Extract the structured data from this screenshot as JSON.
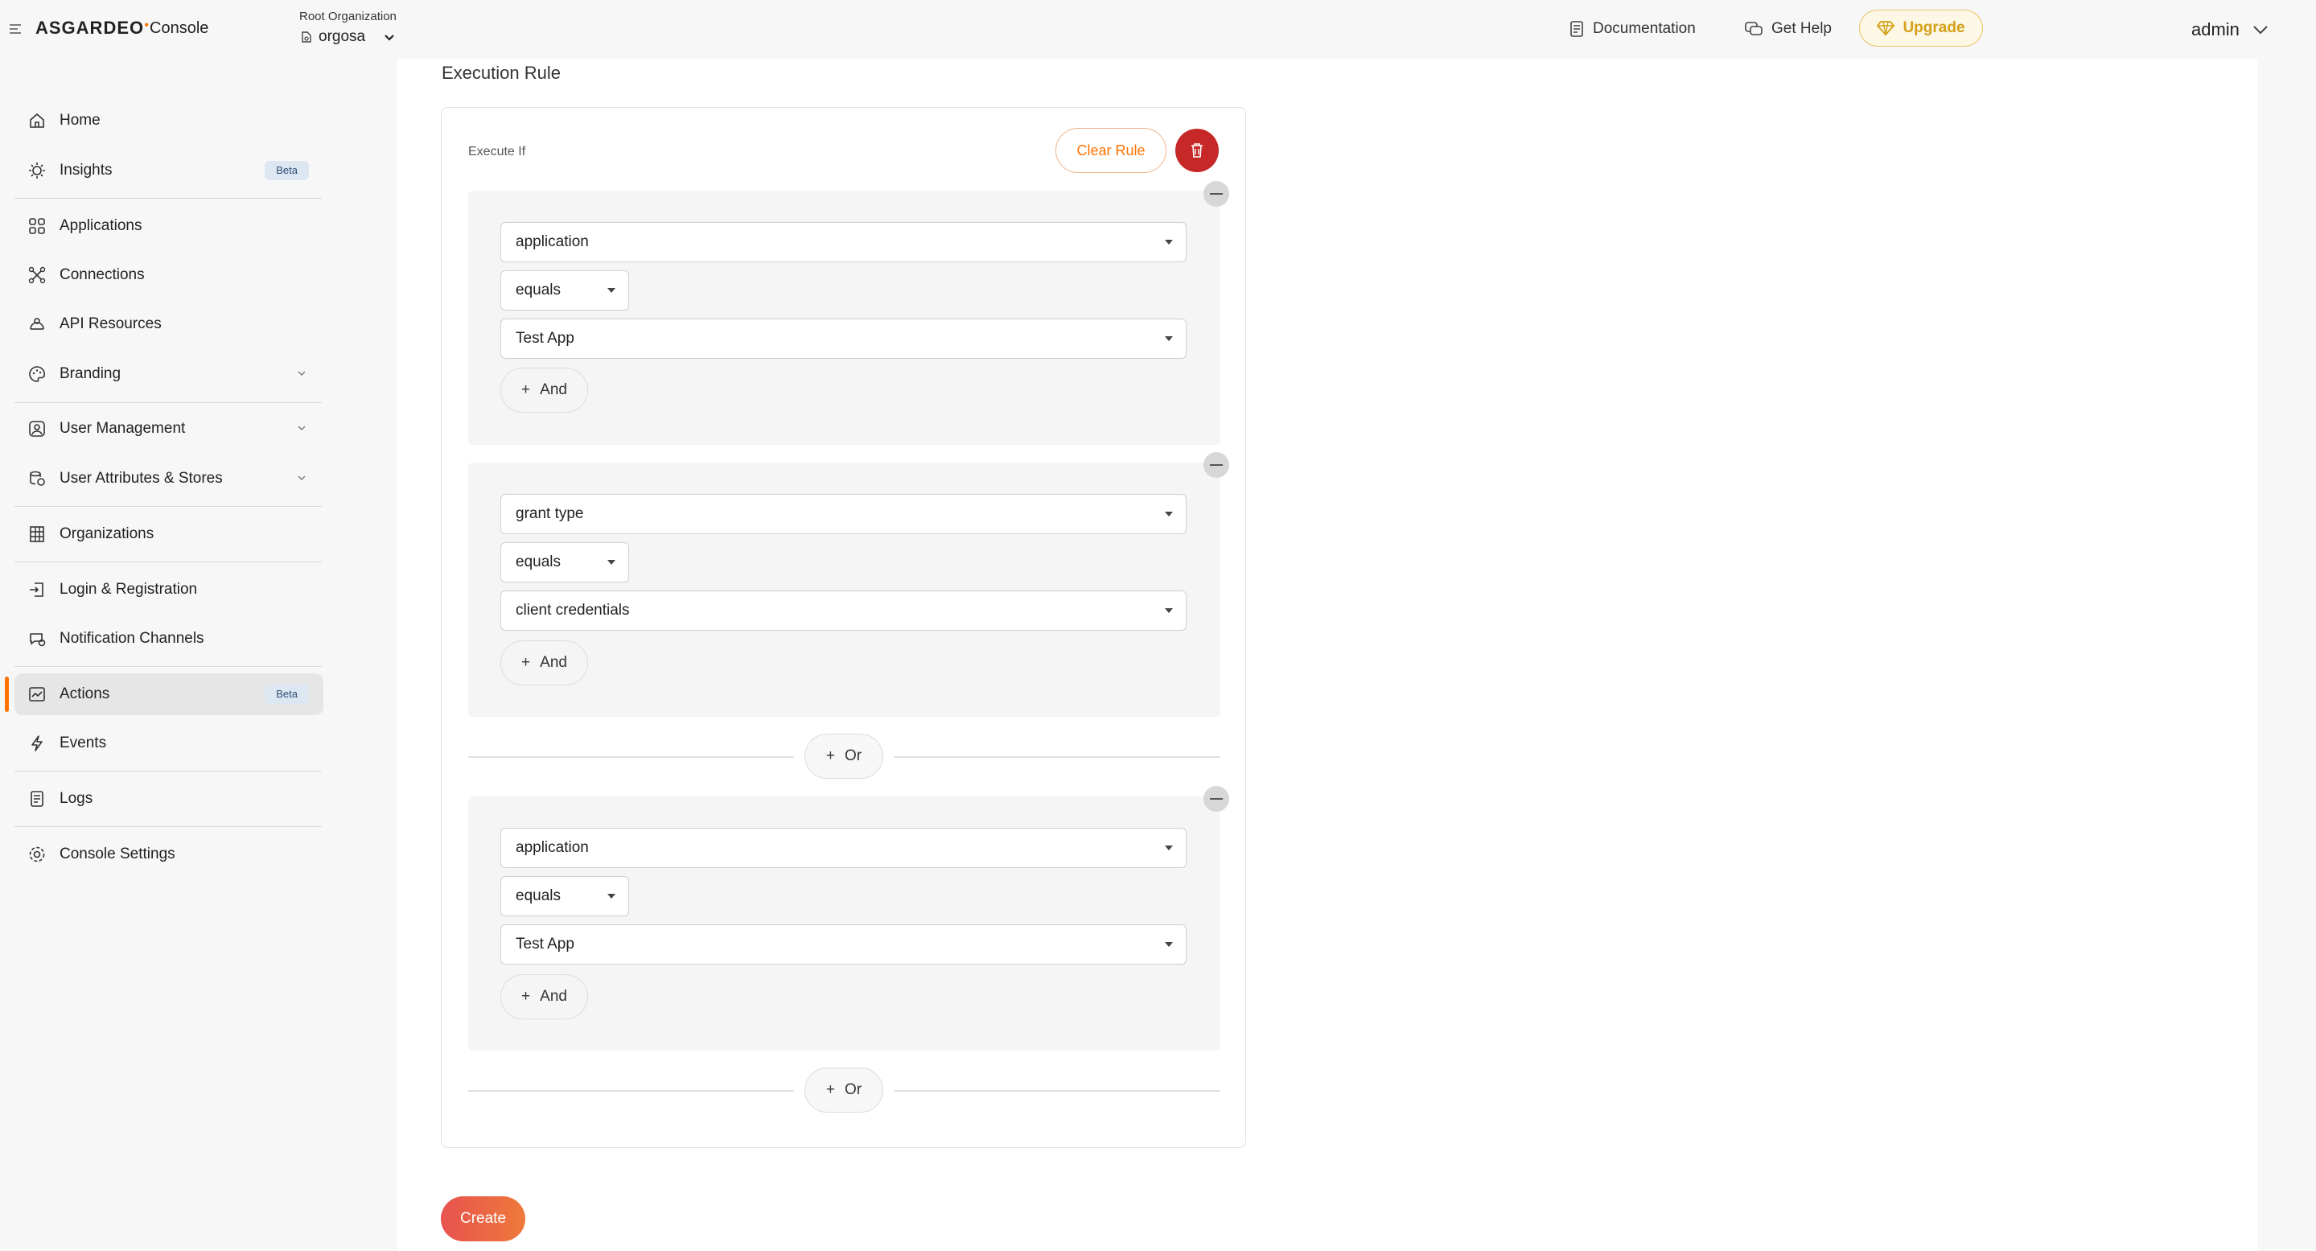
{
  "header": {
    "brand": "ASGARDEO",
    "product": "Console",
    "org_label": "Root Organization",
    "org_name": "orgosa",
    "documentation": "Documentation",
    "get_help": "Get Help",
    "upgrade": "Upgrade",
    "user": "admin"
  },
  "sidebar": {
    "items": [
      {
        "label": "Home",
        "icon": "home-icon"
      },
      {
        "label": "Insights",
        "icon": "lightbulb-icon",
        "badge": "Beta"
      },
      {
        "label": "Applications",
        "icon": "grid-icon"
      },
      {
        "label": "Connections",
        "icon": "connections-icon"
      },
      {
        "label": "API Resources",
        "icon": "api-icon"
      },
      {
        "label": "Branding",
        "icon": "palette-icon",
        "expandable": true
      },
      {
        "label": "User Management",
        "icon": "users-icon",
        "expandable": true
      },
      {
        "label": "User Attributes & Stores",
        "icon": "attributes-icon",
        "expandable": true
      },
      {
        "label": "Organizations",
        "icon": "building-icon"
      },
      {
        "label": "Login & Registration",
        "icon": "login-icon"
      },
      {
        "label": "Notification Channels",
        "icon": "notification-icon"
      },
      {
        "label": "Actions",
        "icon": "actions-icon",
        "badge": "Beta",
        "active": true
      },
      {
        "label": "Events",
        "icon": "lightning-icon"
      },
      {
        "label": "Logs",
        "icon": "logs-icon"
      },
      {
        "label": "Console Settings",
        "icon": "settings-icon"
      }
    ]
  },
  "main": {
    "section_title": "Execution Rule",
    "execute_if": "Execute If",
    "clear_rule": "Clear Rule",
    "groups": [
      {
        "field": "application",
        "operator": "equals",
        "value": "Test App",
        "and_label": "And"
      },
      {
        "field": "grant type",
        "operator": "equals",
        "value": "client credentials",
        "and_label": "And"
      },
      {
        "field": "application",
        "operator": "equals",
        "value": "Test App",
        "and_label": "And"
      }
    ],
    "or_label": "Or",
    "create": "Create"
  },
  "colors": {
    "accent": "#ff7300",
    "delete": "#c62828",
    "upgrade": "#d4a017"
  }
}
